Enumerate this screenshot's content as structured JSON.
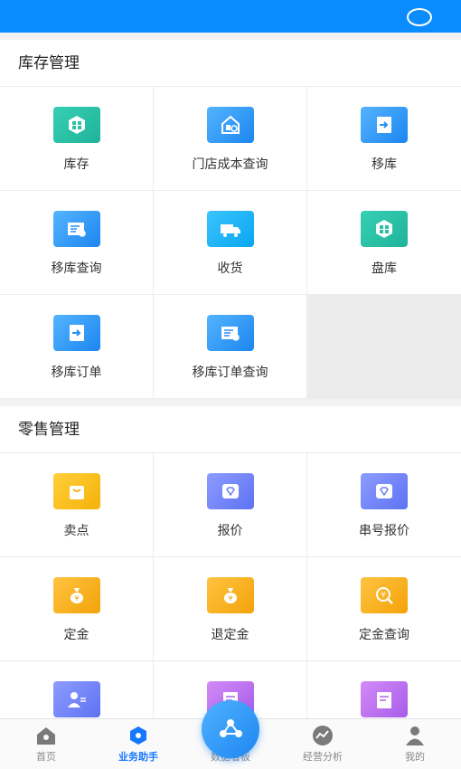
{
  "colors": {
    "status_bar": "#0a8cff",
    "active_tab": "#1677ff"
  },
  "sections": [
    {
      "title": "库存管理",
      "items": [
        {
          "label": "库存",
          "icon": "box-icon",
          "color": "teal"
        },
        {
          "label": "门店成本查询",
          "icon": "store-cost-icon",
          "color": "blue"
        },
        {
          "label": "移库",
          "icon": "transfer-icon",
          "color": "blue"
        },
        {
          "label": "移库查询",
          "icon": "transfer-search-icon",
          "color": "blue"
        },
        {
          "label": "收货",
          "icon": "truck-icon",
          "color": "cyan"
        },
        {
          "label": "盘库",
          "icon": "inventory-check-icon",
          "color": "teal"
        },
        {
          "label": "移库订单",
          "icon": "transfer-order-icon",
          "color": "blue"
        },
        {
          "label": "移库订单查询",
          "icon": "transfer-order-search-icon",
          "color": "blue"
        }
      ]
    },
    {
      "title": "零售管理",
      "items": [
        {
          "label": "卖点",
          "icon": "shopping-bag-icon",
          "color": "yellow"
        },
        {
          "label": "报价",
          "icon": "diamond-tag-icon",
          "color": "indigo"
        },
        {
          "label": "串号报价",
          "icon": "serial-quote-icon",
          "color": "indigo"
        },
        {
          "label": "定金",
          "icon": "money-bag-icon",
          "color": "orange"
        },
        {
          "label": "退定金",
          "icon": "refund-money-bag-icon",
          "color": "orange"
        },
        {
          "label": "定金查询",
          "icon": "deposit-search-icon",
          "color": "orange"
        },
        {
          "label": "",
          "icon": "cashier-user-icon",
          "color": "indigo"
        },
        {
          "label": "",
          "icon": "clipboard-edit-icon",
          "color": "purple"
        },
        {
          "label": "",
          "icon": "clipboard-check-icon",
          "color": "purple"
        }
      ]
    }
  ],
  "tabs": [
    {
      "label": "首页",
      "icon": "home-icon",
      "active": false
    },
    {
      "label": "业务助手",
      "icon": "tag-icon",
      "active": true
    },
    {
      "label": "数据看板",
      "icon": "share-nodes-icon",
      "active": false
    },
    {
      "label": "经营分析",
      "icon": "trend-icon",
      "active": false
    },
    {
      "label": "我的",
      "icon": "user-icon",
      "active": false
    }
  ]
}
